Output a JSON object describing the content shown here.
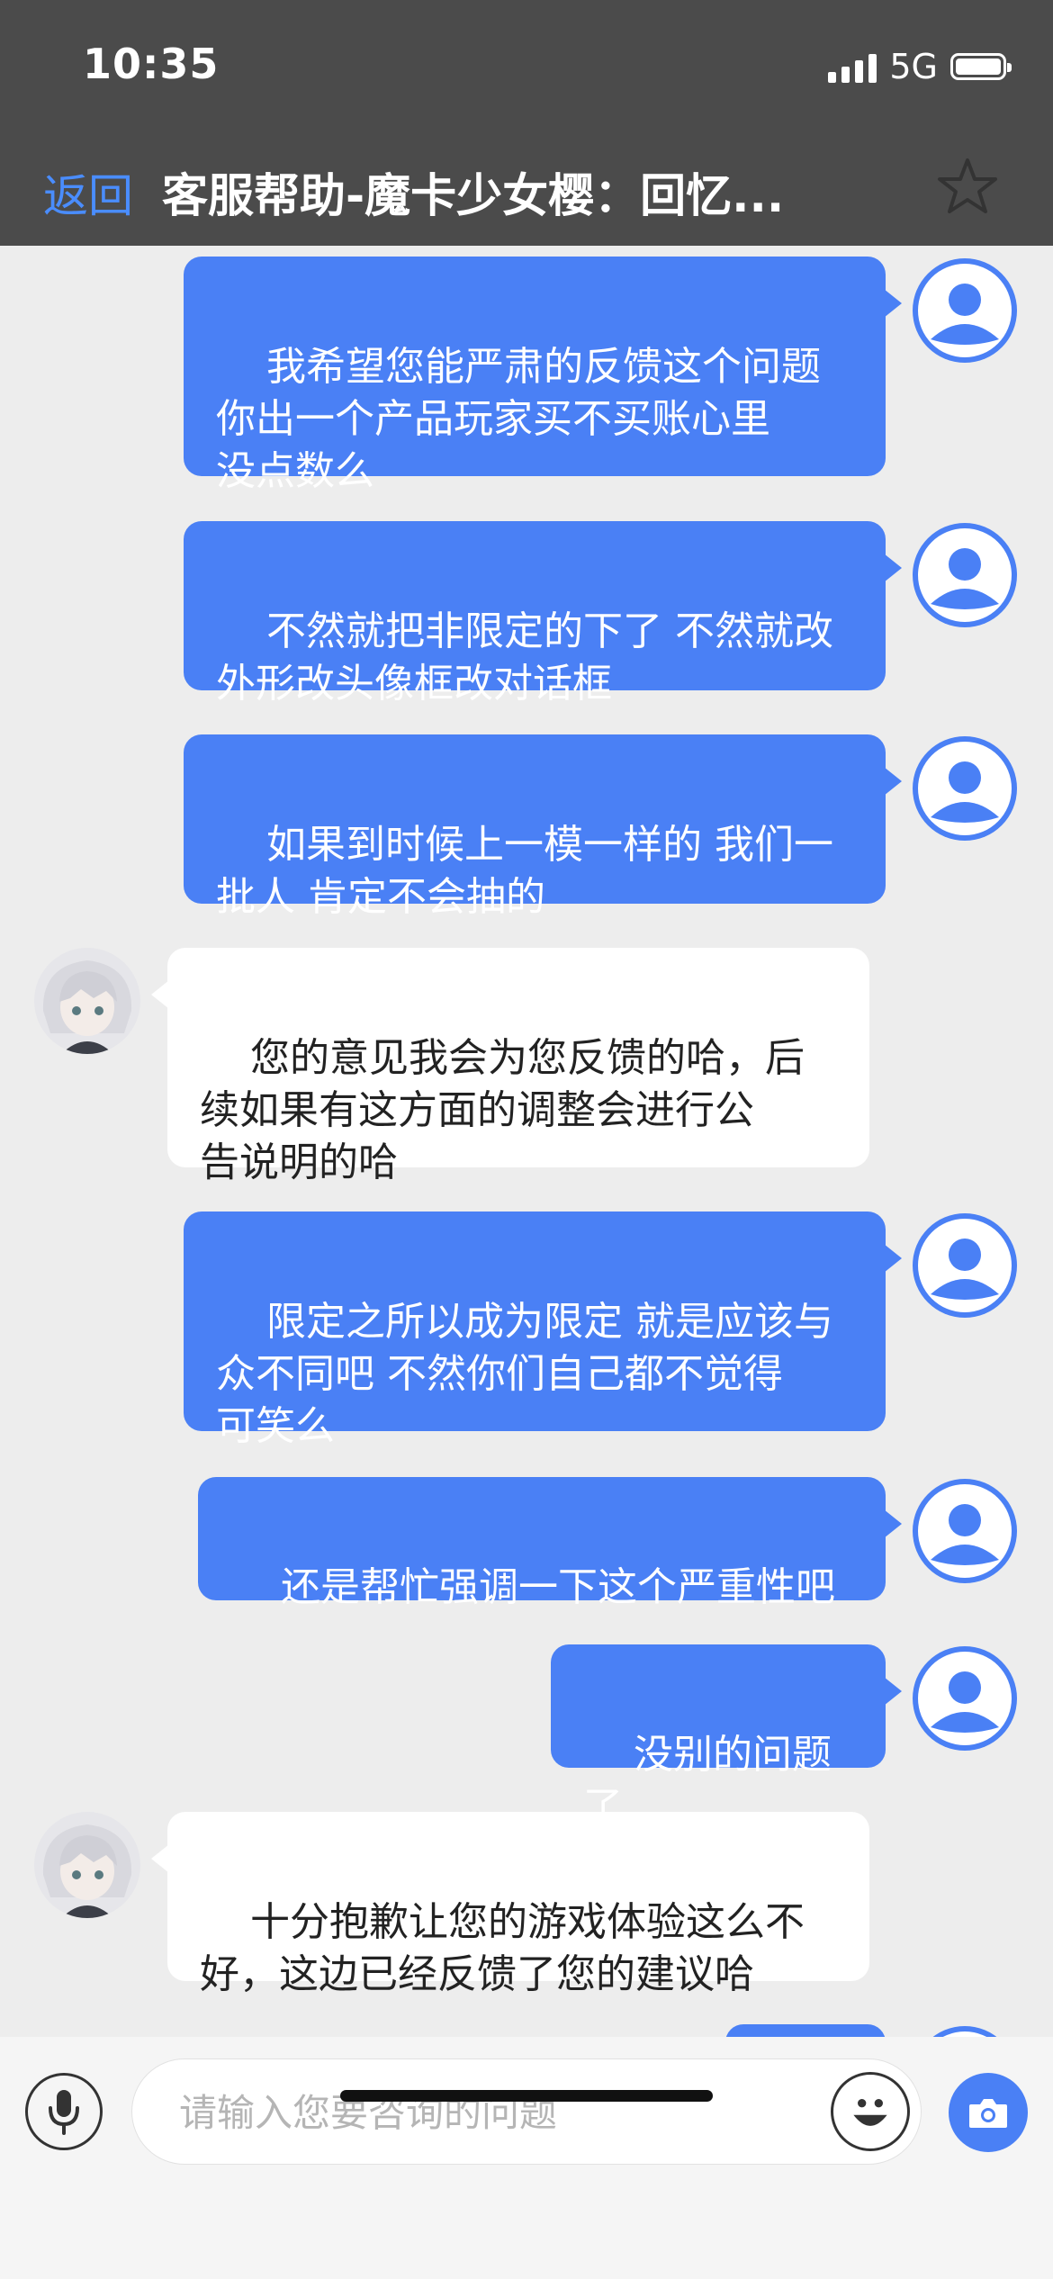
{
  "status_bar": {
    "time": "10:35",
    "network": "5G"
  },
  "nav": {
    "back_label": "返回",
    "title": "客服帮助-魔卡少女樱：回忆..."
  },
  "messages": [
    {
      "sender": "user",
      "text": "我希望您能严肃的反馈这个问题\n你出一个产品玩家买不买账心里\n没点数么"
    },
    {
      "sender": "user",
      "text": "不然就把非限定的下了 不然就改\n外形改头像框改对话框"
    },
    {
      "sender": "user",
      "text": "如果到时候上一模一样的 我们一\n批人 肯定不会抽的"
    },
    {
      "sender": "agent",
      "text": "您的意见我会为您反馈的哈，后\n续如果有这方面的调整会进行公\n告说明的哈"
    },
    {
      "sender": "user",
      "text": "限定之所以成为限定 就是应该与\n众不同吧 不然你们自己都不觉得\n可笑么"
    },
    {
      "sender": "user",
      "text": "还是帮忙强调一下这个严重性吧"
    },
    {
      "sender": "user",
      "text": "没别的问题了"
    },
    {
      "sender": "agent",
      "text": "十分抱歉让您的游戏体验这么不\n好，这边已经反馈了您的建议哈"
    }
  ],
  "input": {
    "placeholder": "请输入您要咨询的问题"
  },
  "colors": {
    "accent": "#4a80f5",
    "header_bg": "#4b4b4b",
    "back_link": "#4a8dff"
  },
  "icons": [
    "star-icon",
    "mic-icon",
    "emoji-icon",
    "camera-icon",
    "user-avatar-icon",
    "agent-avatar"
  ]
}
